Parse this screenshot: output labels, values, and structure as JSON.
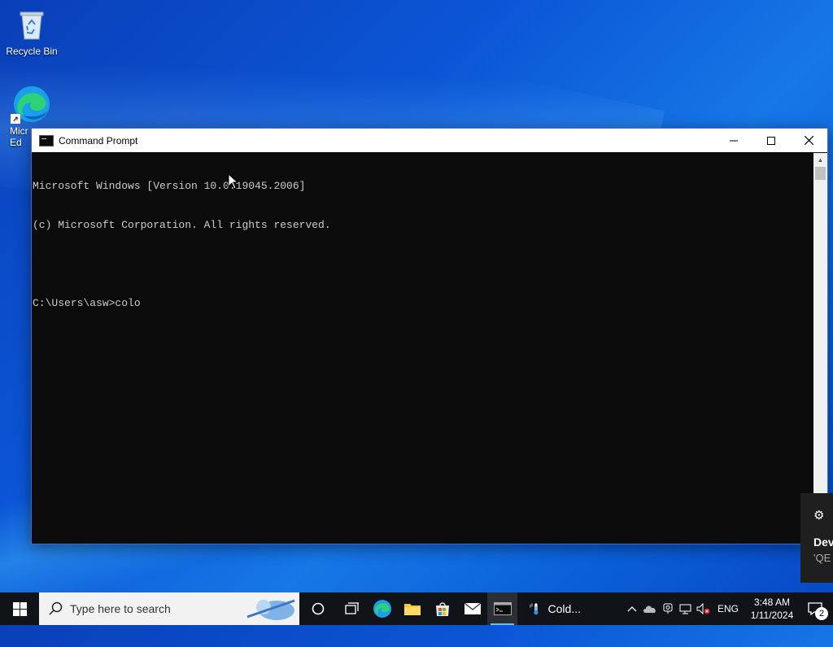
{
  "desktop": {
    "icons": [
      {
        "label": "Recycle Bin"
      },
      {
        "label": "Micr\nEd"
      }
    ]
  },
  "window": {
    "title": "Command Prompt",
    "lines": [
      "Microsoft Windows [Version 10.0.19045.2006]",
      "(c) Microsoft Corporation. All rights reserved.",
      "",
      "C:\\Users\\asw>colo"
    ]
  },
  "toast": {
    "title_fragment": "Dev",
    "body_fragment": "'QE"
  },
  "taskbar": {
    "search_placeholder": "Type here to search",
    "weather_label": "Cold...",
    "language": "ENG",
    "time": "3:48 AM",
    "date": "1/11/2024",
    "notification_count": "2"
  },
  "colors": {
    "console_bg": "#0c0c0c",
    "console_fg": "#cccccc",
    "taskbar_bg": "#101418",
    "accent": "#0078d7"
  }
}
